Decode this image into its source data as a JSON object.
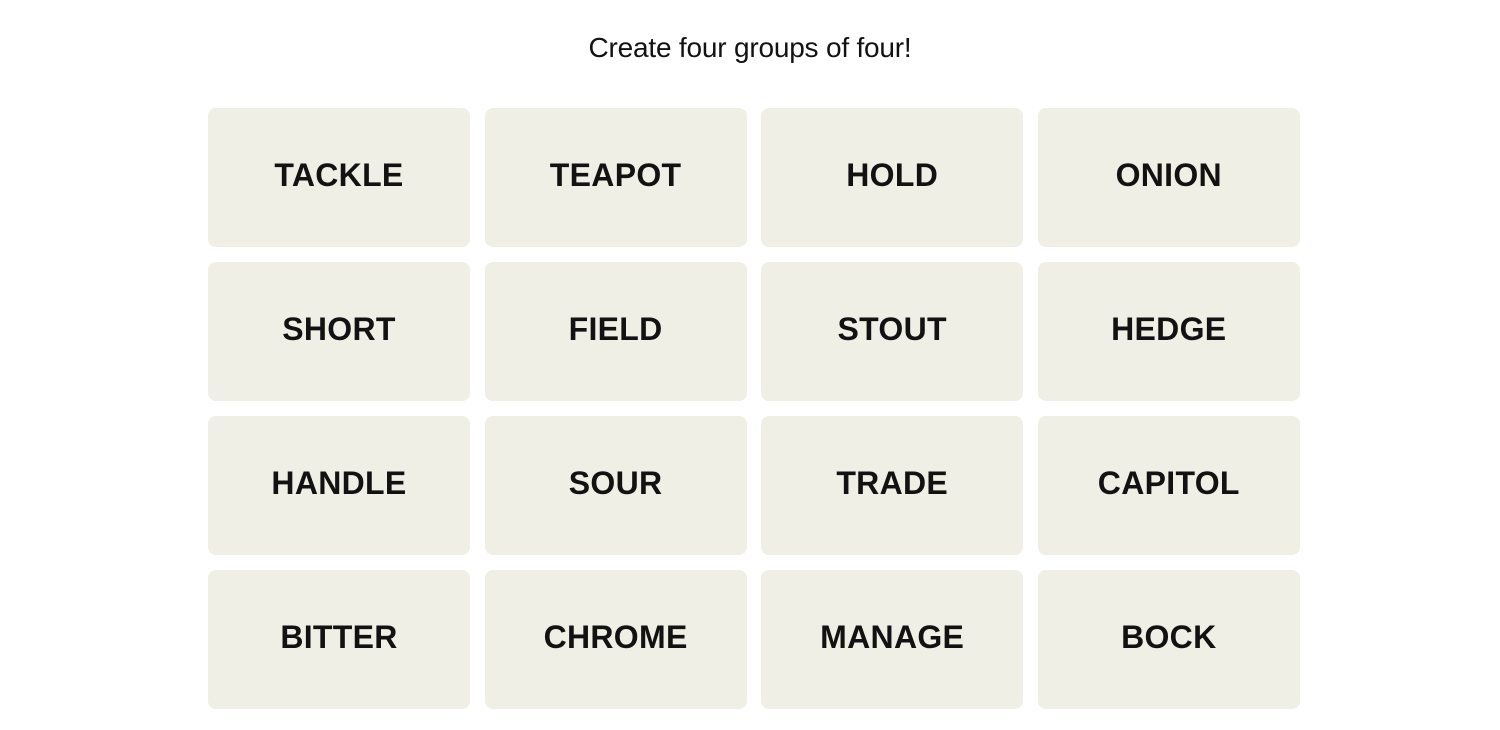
{
  "header": {
    "prompt": "Create four groups of four!"
  },
  "board": {
    "tiles": [
      {
        "label": "TACKLE",
        "selected": false
      },
      {
        "label": "TEAPOT",
        "selected": false
      },
      {
        "label": "HOLD",
        "selected": false
      },
      {
        "label": "ONION",
        "selected": false
      },
      {
        "label": "SHORT",
        "selected": false
      },
      {
        "label": "FIELD",
        "selected": false
      },
      {
        "label": "STOUT",
        "selected": false
      },
      {
        "label": "HEDGE",
        "selected": false
      },
      {
        "label": "HANDLE",
        "selected": false
      },
      {
        "label": "SOUR",
        "selected": false
      },
      {
        "label": "TRADE",
        "selected": false
      },
      {
        "label": "CAPITOL",
        "selected": false
      },
      {
        "label": "BITTER",
        "selected": false
      },
      {
        "label": "CHROME",
        "selected": false
      },
      {
        "label": "MANAGE",
        "selected": false
      },
      {
        "label": "BOCK",
        "selected": false
      }
    ]
  },
  "colors": {
    "tile_background": "#efefe6",
    "text": "#121212",
    "page_background": "#ffffff"
  }
}
